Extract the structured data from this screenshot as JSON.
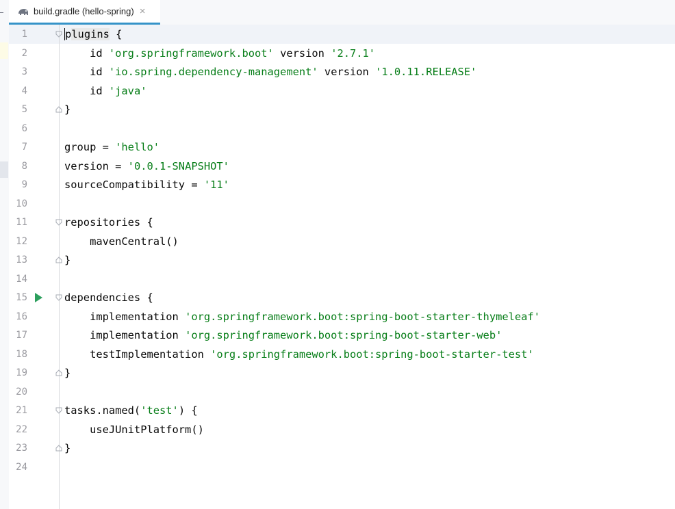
{
  "tab": {
    "title": "build.gradle (hello-spring)",
    "icon": "gradle-elephant-icon",
    "close_icon": "close-icon"
  },
  "editor": {
    "run_line": 15,
    "fold_start_lines": [
      1,
      11,
      15,
      21
    ],
    "fold_end_lines": [
      5,
      13,
      19,
      23
    ],
    "lines": [
      {
        "n": "1",
        "tokens": [
          {
            "t": "p",
            "c": "caret"
          },
          {
            "t": "lugins",
            "c": "hl"
          },
          {
            "t": " {",
            "c": ""
          }
        ]
      },
      {
        "n": "2",
        "tokens": [
          {
            "t": "    id ",
            "c": ""
          },
          {
            "t": "'org.springframework.boot'",
            "c": "str"
          },
          {
            "t": " version ",
            "c": ""
          },
          {
            "t": "'2.7.1'",
            "c": "str"
          }
        ]
      },
      {
        "n": "3",
        "tokens": [
          {
            "t": "    id ",
            "c": ""
          },
          {
            "t": "'io.spring.dependency-management'",
            "c": "str"
          },
          {
            "t": " version ",
            "c": ""
          },
          {
            "t": "'1.0.11.RELEASE'",
            "c": "str"
          }
        ]
      },
      {
        "n": "4",
        "tokens": [
          {
            "t": "    id ",
            "c": ""
          },
          {
            "t": "'java'",
            "c": "str"
          }
        ]
      },
      {
        "n": "5",
        "tokens": [
          {
            "t": "}",
            "c": ""
          }
        ]
      },
      {
        "n": "6",
        "tokens": []
      },
      {
        "n": "7",
        "tokens": [
          {
            "t": "group = ",
            "c": ""
          },
          {
            "t": "'hello'",
            "c": "str"
          }
        ]
      },
      {
        "n": "8",
        "tokens": [
          {
            "t": "version = ",
            "c": ""
          },
          {
            "t": "'0.0.1-SNAPSHOT'",
            "c": "str"
          }
        ]
      },
      {
        "n": "9",
        "tokens": [
          {
            "t": "sourceCompatibility = ",
            "c": ""
          },
          {
            "t": "'11'",
            "c": "str"
          }
        ]
      },
      {
        "n": "10",
        "tokens": []
      },
      {
        "n": "11",
        "tokens": [
          {
            "t": "repositories {",
            "c": ""
          }
        ]
      },
      {
        "n": "12",
        "tokens": [
          {
            "t": "    mavenCentral()",
            "c": ""
          }
        ]
      },
      {
        "n": "13",
        "tokens": [
          {
            "t": "}",
            "c": ""
          }
        ]
      },
      {
        "n": "14",
        "tokens": []
      },
      {
        "n": "15",
        "tokens": [
          {
            "t": "dependencies {",
            "c": ""
          }
        ]
      },
      {
        "n": "16",
        "tokens": [
          {
            "t": "    implementation ",
            "c": ""
          },
          {
            "t": "'org.springframework.boot:spring-boot-starter-thymeleaf'",
            "c": "str"
          }
        ]
      },
      {
        "n": "17",
        "tokens": [
          {
            "t": "    implementation ",
            "c": ""
          },
          {
            "t": "'org.springframework.boot:spring-boot-starter-web'",
            "c": "str"
          }
        ]
      },
      {
        "n": "18",
        "tokens": [
          {
            "t": "    testImplementation ",
            "c": ""
          },
          {
            "t": "'org.springframework.boot:spring-boot-starter-test'",
            "c": "str"
          }
        ]
      },
      {
        "n": "19",
        "tokens": [
          {
            "t": "}",
            "c": ""
          }
        ]
      },
      {
        "n": "20",
        "tokens": []
      },
      {
        "n": "21",
        "tokens": [
          {
            "t": "tasks.named(",
            "c": ""
          },
          {
            "t": "'test'",
            "c": "str"
          },
          {
            "t": ") {",
            "c": ""
          }
        ]
      },
      {
        "n": "22",
        "tokens": [
          {
            "t": "    useJUnitPlatform()",
            "c": ""
          }
        ]
      },
      {
        "n": "23",
        "tokens": [
          {
            "t": "}",
            "c": ""
          }
        ]
      },
      {
        "n": "24",
        "tokens": []
      }
    ]
  },
  "colors": {
    "string": "#067d17",
    "text": "#080808",
    "line_number": "#9a9aa0",
    "tab_underline": "#3593c8",
    "run": "#2c9f5d"
  }
}
